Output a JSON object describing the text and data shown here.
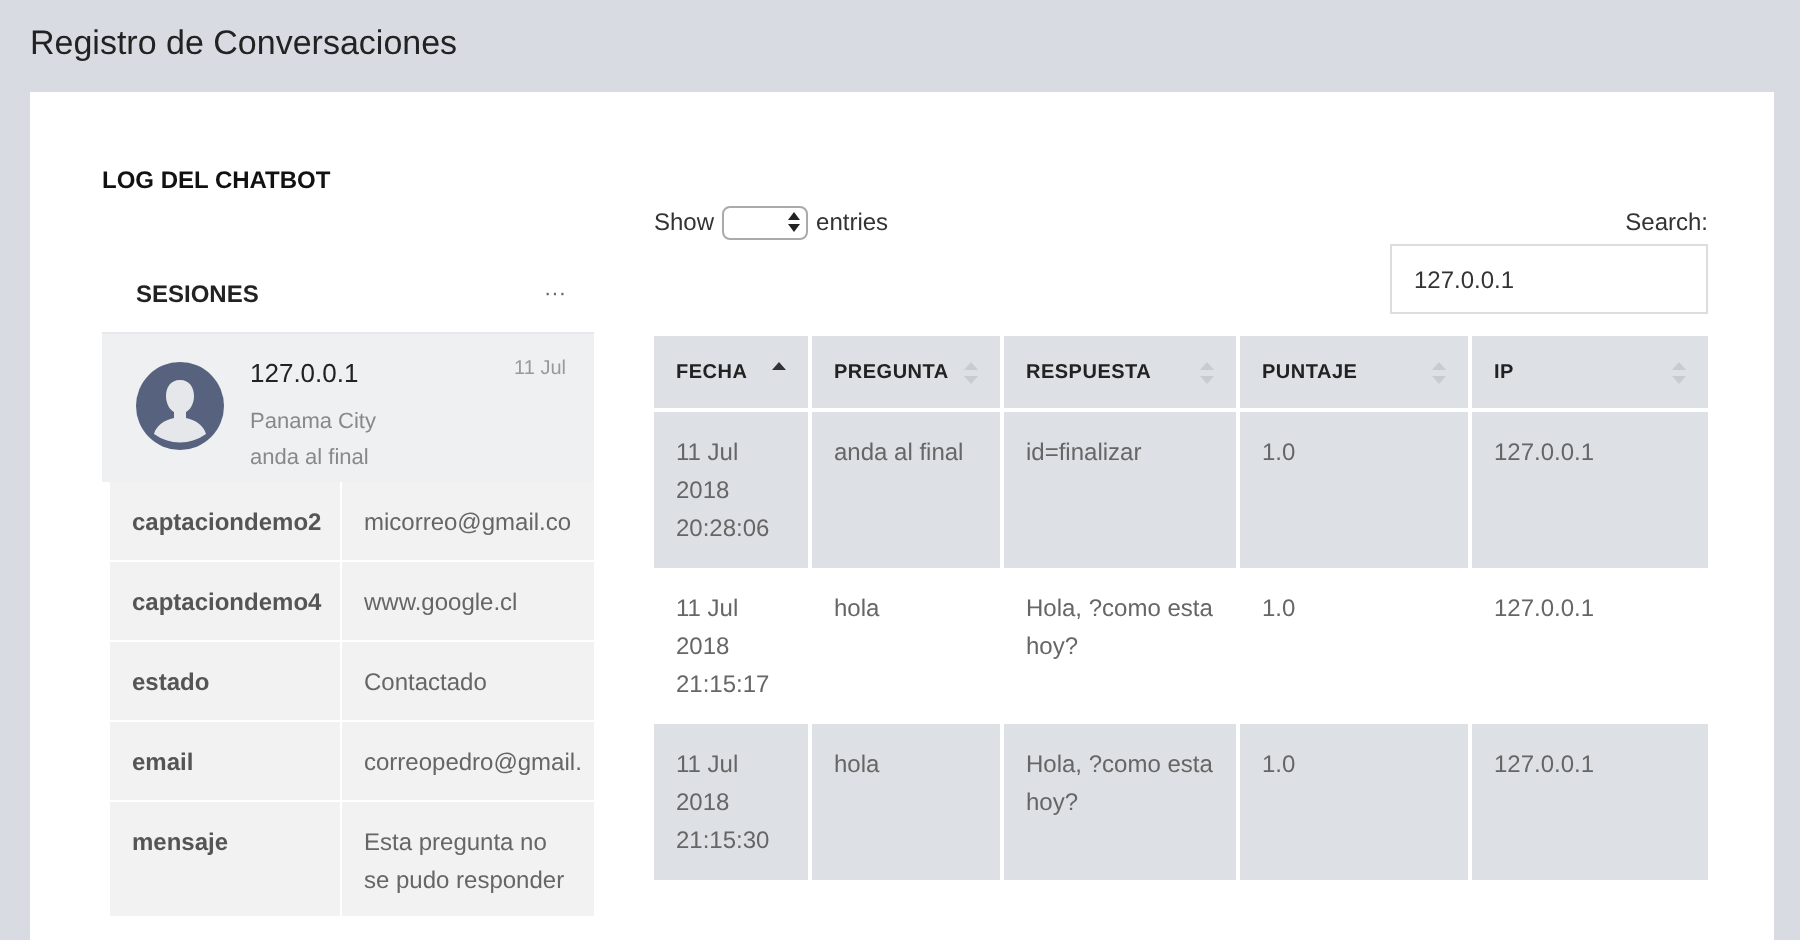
{
  "page_title": "Registro de Conversaciones",
  "card_title": "LOG DEL CHATBOT",
  "sessions": {
    "title": "SESIONES",
    "menu": "···",
    "items": [
      {
        "ip": "127.0.0.1",
        "date": "11 Jul",
        "city": "Panama City",
        "last_message": "anda al final",
        "selected": true
      }
    ]
  },
  "attributes": [
    {
      "key": "captaciondemo2",
      "value": "micorreo@gmail.co"
    },
    {
      "key": "captaciondemo4",
      "value": "www.google.cl"
    },
    {
      "key": "estado",
      "value": "Contactado"
    },
    {
      "key": "email",
      "value": "correopedro@gmail."
    },
    {
      "key": "mensaje",
      "value": "Esta pregunta no se pudo responder"
    }
  ],
  "length_control": {
    "before": "Show",
    "after": "entries"
  },
  "search": {
    "label": "Search:",
    "value": "127.0.0.1"
  },
  "table": {
    "columns": [
      {
        "label": "FECHA",
        "sorted": true
      },
      {
        "label": "PREGUNTA",
        "sorted": false
      },
      {
        "label": "RESPUESTA",
        "sorted": false
      },
      {
        "label": "PUNTAJE",
        "sorted": false
      },
      {
        "label": "IP",
        "sorted": false
      }
    ],
    "rows": [
      [
        "11 Jul 2018 20:28:06",
        "anda al final",
        "id=finalizar",
        "1.0",
        "127.0.0.1"
      ],
      [
        "11 Jul 2018 21:15:17",
        "hola",
        "Hola, ?como esta hoy?",
        "1.0",
        "127.0.0.1"
      ],
      [
        "11 Jul 2018 21:15:30",
        "hola",
        "Hola, ?como esta hoy?",
        "1.0",
        "127.0.0.1"
      ]
    ]
  }
}
